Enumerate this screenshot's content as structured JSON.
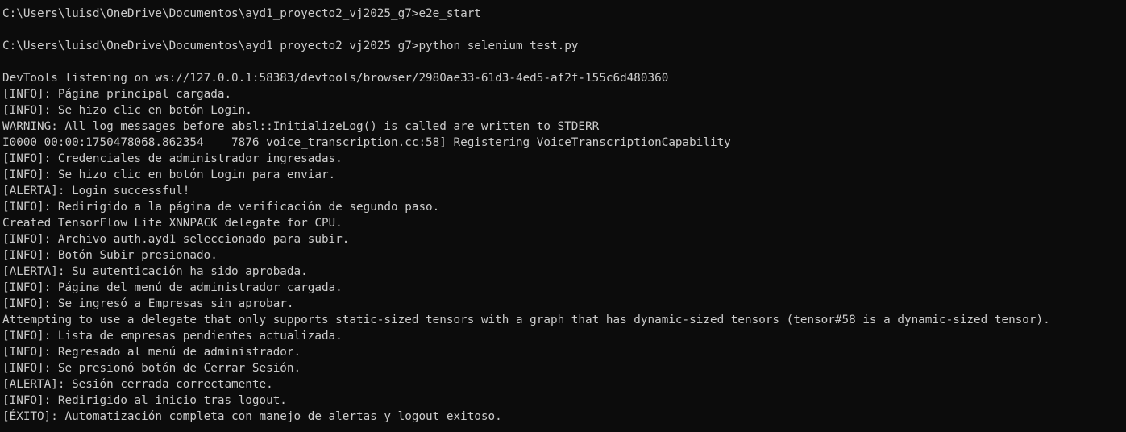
{
  "terminal": {
    "lines": [
      "C:\\Users\\luisd\\OneDrive\\Documentos\\ayd1_proyecto2_vj2025_g7>e2e_start",
      "",
      "C:\\Users\\luisd\\OneDrive\\Documentos\\ayd1_proyecto2_vj2025_g7>python selenium_test.py",
      "",
      "DevTools listening on ws://127.0.0.1:58383/devtools/browser/2980ae33-61d3-4ed5-af2f-155c6d480360",
      "[INFO]: Página principal cargada.",
      "[INFO]: Se hizo clic en botón Login.",
      "WARNING: All log messages before absl::InitializeLog() is called are written to STDERR",
      "I0000 00:00:1750478068.862354    7876 voice_transcription.cc:58] Registering VoiceTranscriptionCapability",
      "[INFO]: Credenciales de administrador ingresadas.",
      "[INFO]: Se hizo clic en botón Login para enviar.",
      "[ALERTA]: Login successful!",
      "[INFO]: Redirigido a la página de verificación de segundo paso.",
      "Created TensorFlow Lite XNNPACK delegate for CPU.",
      "[INFO]: Archivo auth.ayd1 seleccionado para subir.",
      "[INFO]: Botón Subir presionado.",
      "[ALERTA]: Su autenticación ha sido aprobada.",
      "[INFO]: Página del menú de administrador cargada.",
      "[INFO]: Se ingresó a Empresas sin aprobar.",
      "Attempting to use a delegate that only supports static-sized tensors with a graph that has dynamic-sized tensors (tensor#58 is a dynamic-sized tensor).",
      "[INFO]: Lista de empresas pendientes actualizada.",
      "[INFO]: Regresado al menú de administrador.",
      "[INFO]: Se presionó botón de Cerrar Sesión.",
      "[ALERTA]: Sesión cerrada correctamente.",
      "[INFO]: Redirigido al inicio tras logout.",
      "[ÉXITO]: Automatización completa con manejo de alertas y logout exitoso."
    ]
  }
}
